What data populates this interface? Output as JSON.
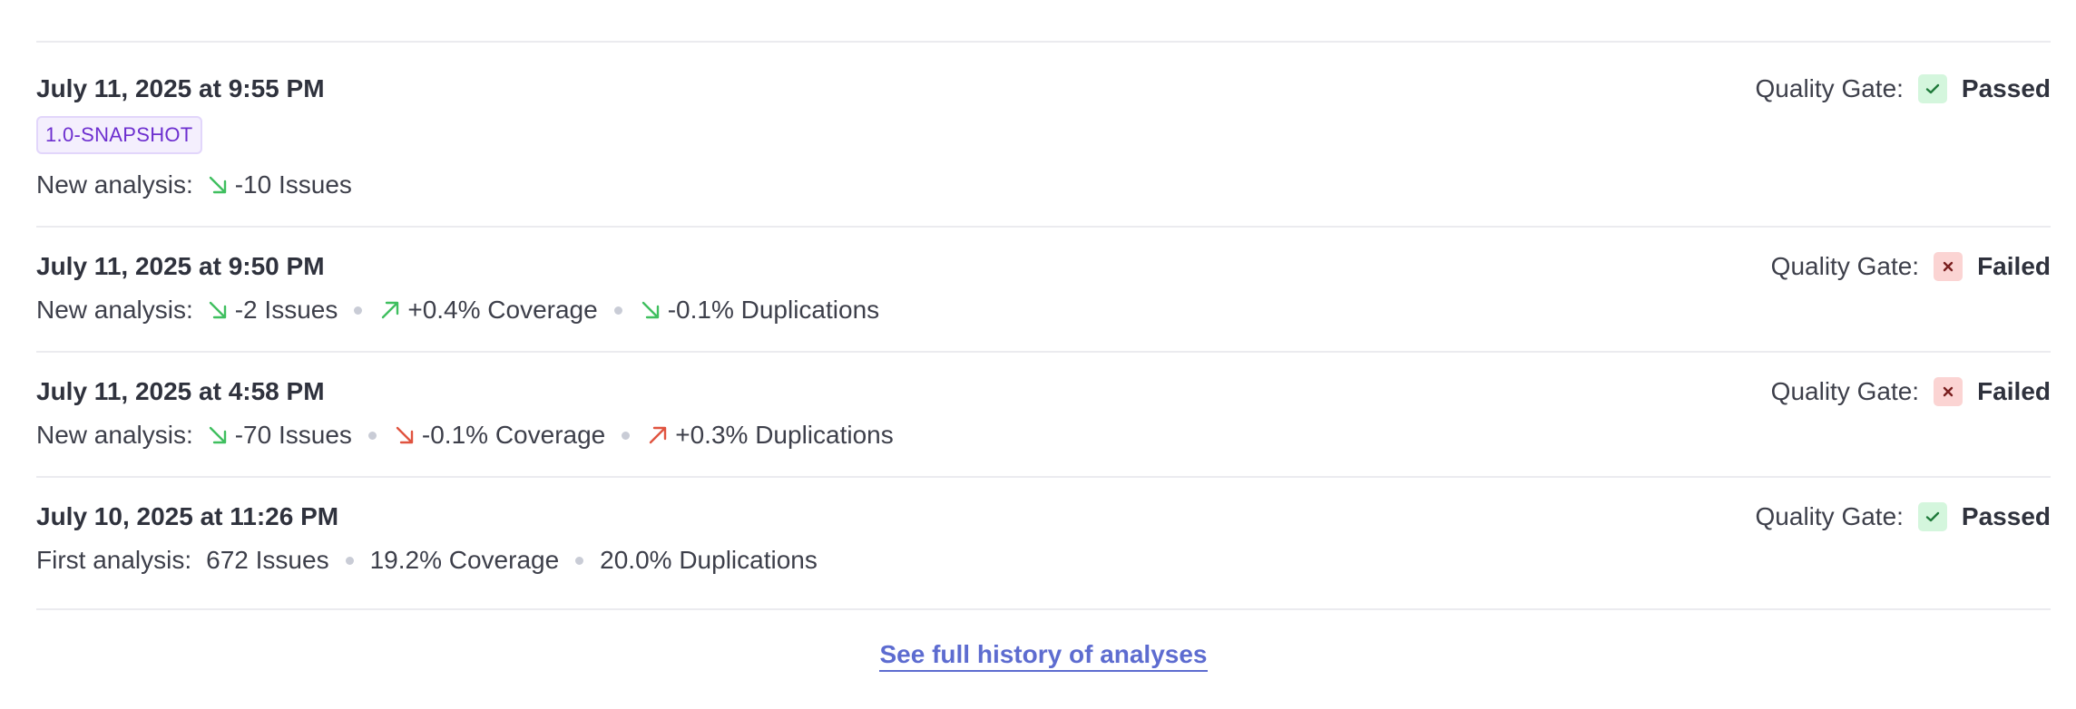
{
  "analyses": [
    {
      "date": "July 11, 2025 at 9:55 PM",
      "version_badge": "1.0-SNAPSHOT",
      "quality_gate_label": "Quality Gate:",
      "quality_gate_status": "Passed",
      "gate_icon": "check-icon",
      "lead": "New analysis:",
      "metrics": [
        {
          "text": "-10 Issues",
          "arrow": "arrow-down-right-icon",
          "color": "#3fbf5f"
        }
      ]
    },
    {
      "date": "July 11, 2025 at 9:50 PM",
      "quality_gate_label": "Quality Gate:",
      "quality_gate_status": "Failed",
      "gate_icon": "cross-icon",
      "lead": "New analysis:",
      "metrics": [
        {
          "text": "-2 Issues",
          "arrow": "arrow-down-right-icon",
          "color": "#3fbf5f"
        },
        {
          "text": "+0.4% Coverage",
          "arrow": "arrow-up-right-icon",
          "color": "#3fbf5f"
        },
        {
          "text": "-0.1% Duplications",
          "arrow": "arrow-down-right-icon",
          "color": "#3fbf5f"
        }
      ]
    },
    {
      "date": "July 11, 2025 at 4:58 PM",
      "quality_gate_label": "Quality Gate:",
      "quality_gate_status": "Failed",
      "gate_icon": "cross-icon",
      "lead": "New analysis:",
      "metrics": [
        {
          "text": "-70 Issues",
          "arrow": "arrow-down-right-icon",
          "color": "#3fbf5f"
        },
        {
          "text": "-0.1% Coverage",
          "arrow": "arrow-down-right-icon",
          "color": "#e0533f"
        },
        {
          "text": "+0.3% Duplications",
          "arrow": "arrow-up-right-icon",
          "color": "#e0533f"
        }
      ]
    },
    {
      "date": "July 10, 2025 at 11:26 PM",
      "quality_gate_label": "Quality Gate:",
      "quality_gate_status": "Passed",
      "gate_icon": "check-icon",
      "lead": "First analysis:",
      "metrics": [
        {
          "text": "672 Issues"
        },
        {
          "text": "19.2% Coverage"
        },
        {
          "text": "20.0% Duplications"
        }
      ]
    }
  ],
  "history_link": "See full history of analyses"
}
